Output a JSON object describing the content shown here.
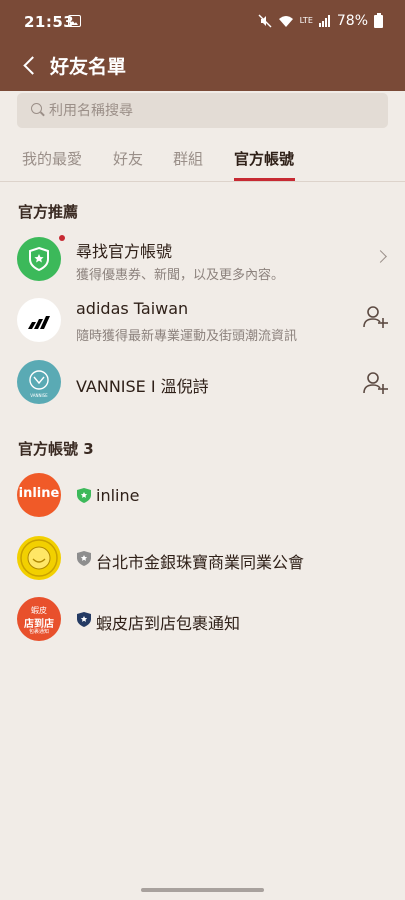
{
  "status": {
    "time": "21:53",
    "battery": "78%",
    "net": "LTE"
  },
  "title": "好友名單",
  "search": {
    "placeholder": "利用名稱搜尋"
  },
  "tabs": [
    "我的最愛",
    "好友",
    "群組",
    "官方帳號"
  ],
  "recommend": {
    "heading": "官方推薦",
    "items": [
      {
        "title": "尋找官方帳號",
        "sub": "獲得優惠券、新聞，以及更多內容。"
      },
      {
        "title": "adidas Taiwan",
        "sub": "隨時獲得最新專業運動及街頭潮流資訊"
      },
      {
        "title": "VANNISE I 溫倪詩",
        "logo_text": "VANNISE"
      }
    ]
  },
  "official": {
    "heading": "官方帳號 3",
    "items": [
      {
        "name": "inline",
        "logo_text": "inline",
        "shield": "green"
      },
      {
        "name": "台北市金銀珠寶商業同業公會",
        "shield": "gray"
      },
      {
        "name": "蝦皮店到店包裹通知",
        "logo_text_1": "蝦皮",
        "logo_text_2": "店到店",
        "logo_text_3": "包裹通知",
        "shield": "navy"
      }
    ]
  },
  "colors": {
    "header": "#7a4a37",
    "accent": "#c72a33",
    "line_green": "#3cb95a"
  }
}
